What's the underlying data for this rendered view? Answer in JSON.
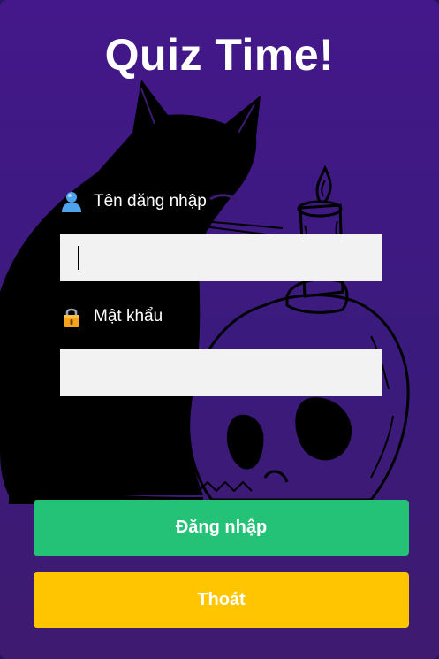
{
  "title": "Quiz Time!",
  "username": {
    "label": "Tên đăng nhập",
    "icon": "user-icon",
    "value": ""
  },
  "password": {
    "label": "Mật khẩu",
    "icon": "lock-icon",
    "value": ""
  },
  "buttons": {
    "login_label": "Đăng nhập",
    "exit_label": "Thoát"
  },
  "colors": {
    "background": "#44188a",
    "login_button": "#24c276",
    "exit_button": "#ffc500",
    "input_background": "#f2f2f2",
    "text": "#ffffff"
  }
}
